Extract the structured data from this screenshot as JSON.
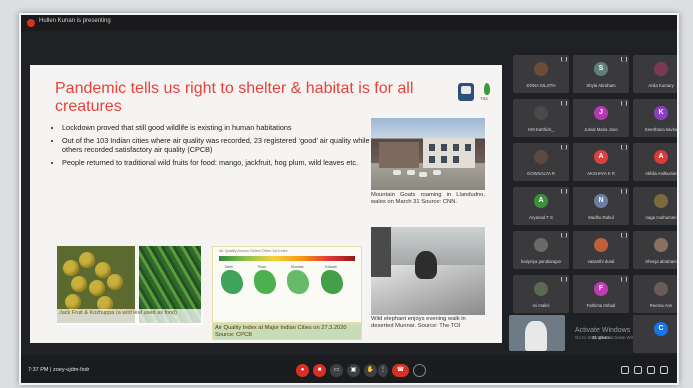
{
  "presenting_banner": "Hullen Kunan is presenting",
  "meeting": {
    "time": "7:37 PM",
    "code": "zoey-ujdm-fxdr"
  },
  "slide": {
    "title": "Pandemic tells us right to shelter & habitat is for all creatures",
    "bullets": [
      "Lockdown proved that still good wildlife is existing in human habitations",
      "Out of the 103 Indian cities where air quality was recorded, 23 registered ‘good’ air quality while 65 others recorded satisfactory air quality (CPCB)",
      "People returned to traditional wild fruits for food: mango, jackfruit, hog plum, wild leaves etc."
    ],
    "captions": {
      "goats": "Mountain Goats roaming in Llandudno, wales on March 31 Source: CNN.",
      "fruits": "Jack Fruit & Kozhuppa (a wild leaf used as food)",
      "aqi": "Air Quality Index at Major Indian Cities on 27.3.2020 Source: CPCB",
      "elephant": "Wild elephant enjoys evening walk in deserted Munnar. Source: The TOI"
    },
    "aqi_chart_title": "Air Quality Across Select Cities 1st Index",
    "aqi_city_labels": [
      "Delhi",
      "Pune",
      "Mumbai",
      "Kolkata"
    ],
    "logo_text": "TSS"
  },
  "participants": [
    {
      "name": "DONA SILJITH",
      "initial": "",
      "color": "#6b4b3a"
    },
    {
      "name": "Shyla Abraham",
      "initial": "S",
      "color": "#5f7f7a"
    },
    {
      "name": "Anila Kumary",
      "initial": "",
      "color": "#7a3b52"
    },
    {
      "name": "KM Karthick_",
      "initial": "",
      "color": "#4a4a4a"
    },
    {
      "name": "Junial Maria Jose",
      "initial": "J",
      "color": "#b23ab3"
    },
    {
      "name": "Keerthana kavitu",
      "initial": "K",
      "color": "#8a3fc2"
    },
    {
      "name": "GOWSALYA R",
      "initial": "",
      "color": "#5a4a40"
    },
    {
      "name": "AKSHAYA K R",
      "initial": "A",
      "color": "#e04040"
    },
    {
      "name": "Akhila Anilkumar",
      "initial": "A",
      "color": "#d93a3a"
    },
    {
      "name": "Aryanad T S",
      "initial": "A",
      "color": "#3c8f3c"
    },
    {
      "name": "Madhu Rahul",
      "initial": "N",
      "color": "#6a7fa3"
    },
    {
      "name": "naga muthumari",
      "initial": "",
      "color": "#7a6b3a"
    },
    {
      "name": "haripriya pandiarajan",
      "initial": "",
      "color": "#6a6a6a"
    },
    {
      "name": "vasanthi dural",
      "initial": "",
      "color": "#c0603a"
    },
    {
      "name": "Sheeja abraham",
      "initial": "",
      "color": "#8a7060"
    },
    {
      "name": "sri malini",
      "initial": "",
      "color": "#5a6a50"
    },
    {
      "name": "Fathima Irshad",
      "initial": "F",
      "color": "#c03ab0"
    },
    {
      "name": "Reema Ann",
      "initial": "",
      "color": "#6a5a5a"
    }
  ],
  "self_tile_label": "",
  "watermark": {
    "line1": "Activate Windows",
    "line2": "Go to Settings to activate Windows."
  },
  "others_label": "21 others",
  "last_tile": {
    "initial": "C",
    "color": "#1a73e8"
  }
}
